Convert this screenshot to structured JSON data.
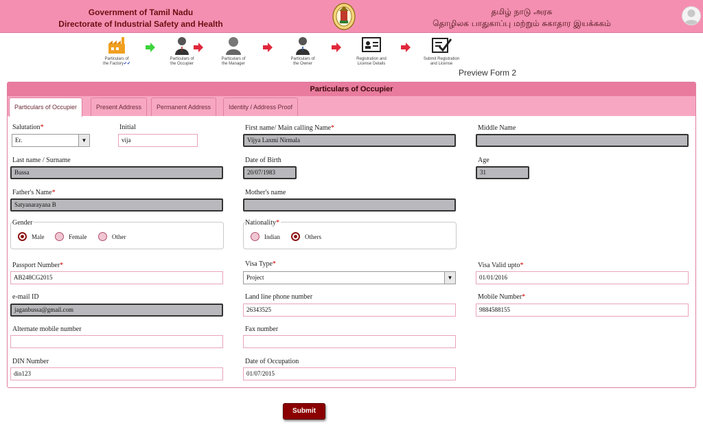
{
  "header": {
    "gov_line1": "Government of Tamil Nadu",
    "gov_line2": "Directorate of Industrial Safety and Health",
    "tamil_line1": "தமிழ் நாடு அரசு",
    "tamil_line2": "தொழிலக பாதுகாப்பு மற்றும் சுகாதார இயக்ககம்",
    "emblem_icon": "tn-emblem-icon",
    "avatar_icon": "user-avatar-icon"
  },
  "steps": [
    {
      "label1": "Particulars of",
      "label2": "the Factory",
      "icon": "factory-icon"
    },
    {
      "label1": "Particulars of",
      "label2": "the Occupier",
      "icon": "person-icon"
    },
    {
      "label1": "Particulars of",
      "label2": "the Manager",
      "icon": "manager-icon"
    },
    {
      "label1": "Particulars of",
      "label2": "the Owner",
      "icon": "owner-icon"
    },
    {
      "label1": "Registration and",
      "label2": "License Details",
      "icon": "id-card-icon"
    },
    {
      "label1": "Submit Registration",
      "label2": "and License",
      "icon": "checkmark-document-icon"
    }
  ],
  "step1_marks": "✔✔",
  "preview_link": "Preview Form 2",
  "panel_title": "Particulars of Occupier",
  "tabs": [
    "Particulars of Occupier",
    "Present Address",
    "Permanent Address",
    "Identity / Address Proof"
  ],
  "form": {
    "salutation_label": "Salutation",
    "salutation_value": "Er.",
    "initial_label": "Initial",
    "initial_value": "vija",
    "first_name_label": "First name/ Main calling Name",
    "first_name_value": "Vijya Laxmi Nirmala",
    "middle_name_label": "Middle Name",
    "middle_name_value": "",
    "last_name_label": "Last name / Surname",
    "last_name_value": "Bussa",
    "dob_label": "Date of Birth",
    "dob_value": "20/07/1983",
    "age_label": "Age",
    "age_value": "31",
    "father_label": "Father's Name",
    "father_value": "Satyanarayana B",
    "mother_label": "Mother's name",
    "mother_value": "",
    "gender_label": "Gender",
    "gender_options": [
      "Male",
      "Female",
      "Other"
    ],
    "nationality_label": "Nationality",
    "nationality_options": [
      "Indian",
      "Others"
    ],
    "passport_label": "Passport Number",
    "passport_value": "AB248CG2015",
    "visa_type_label": "Visa Type",
    "visa_type_value": "Project",
    "visa_valid_label": "Visa Valid upto",
    "visa_valid_value": "01/01/2016",
    "email_label": "e-mail ID",
    "email_value": "jaganbussa@gmail.com",
    "landline_label": "Land line phone number",
    "landline_value": "26343525",
    "mobile_label": "Mobile Number",
    "mobile_value": "9884588155",
    "alt_mobile_label": "Alternate mobile number",
    "alt_mobile_value": "",
    "fax_label": "Fax number",
    "fax_value": "",
    "din_label": "DIN Number",
    "din_value": "din123",
    "occupation_label": "Date of Occupation",
    "occupation_value": "01/07/2015",
    "required_mark": "*"
  },
  "submit_label": "Submit",
  "colors": {
    "header_bg": "#f48fb1",
    "tab_bg": "#f7a7c2",
    "panel_title_bg": "#e87b9e",
    "submit_bg": "#8b0000",
    "readonly_bg": "#b9b9bd"
  }
}
